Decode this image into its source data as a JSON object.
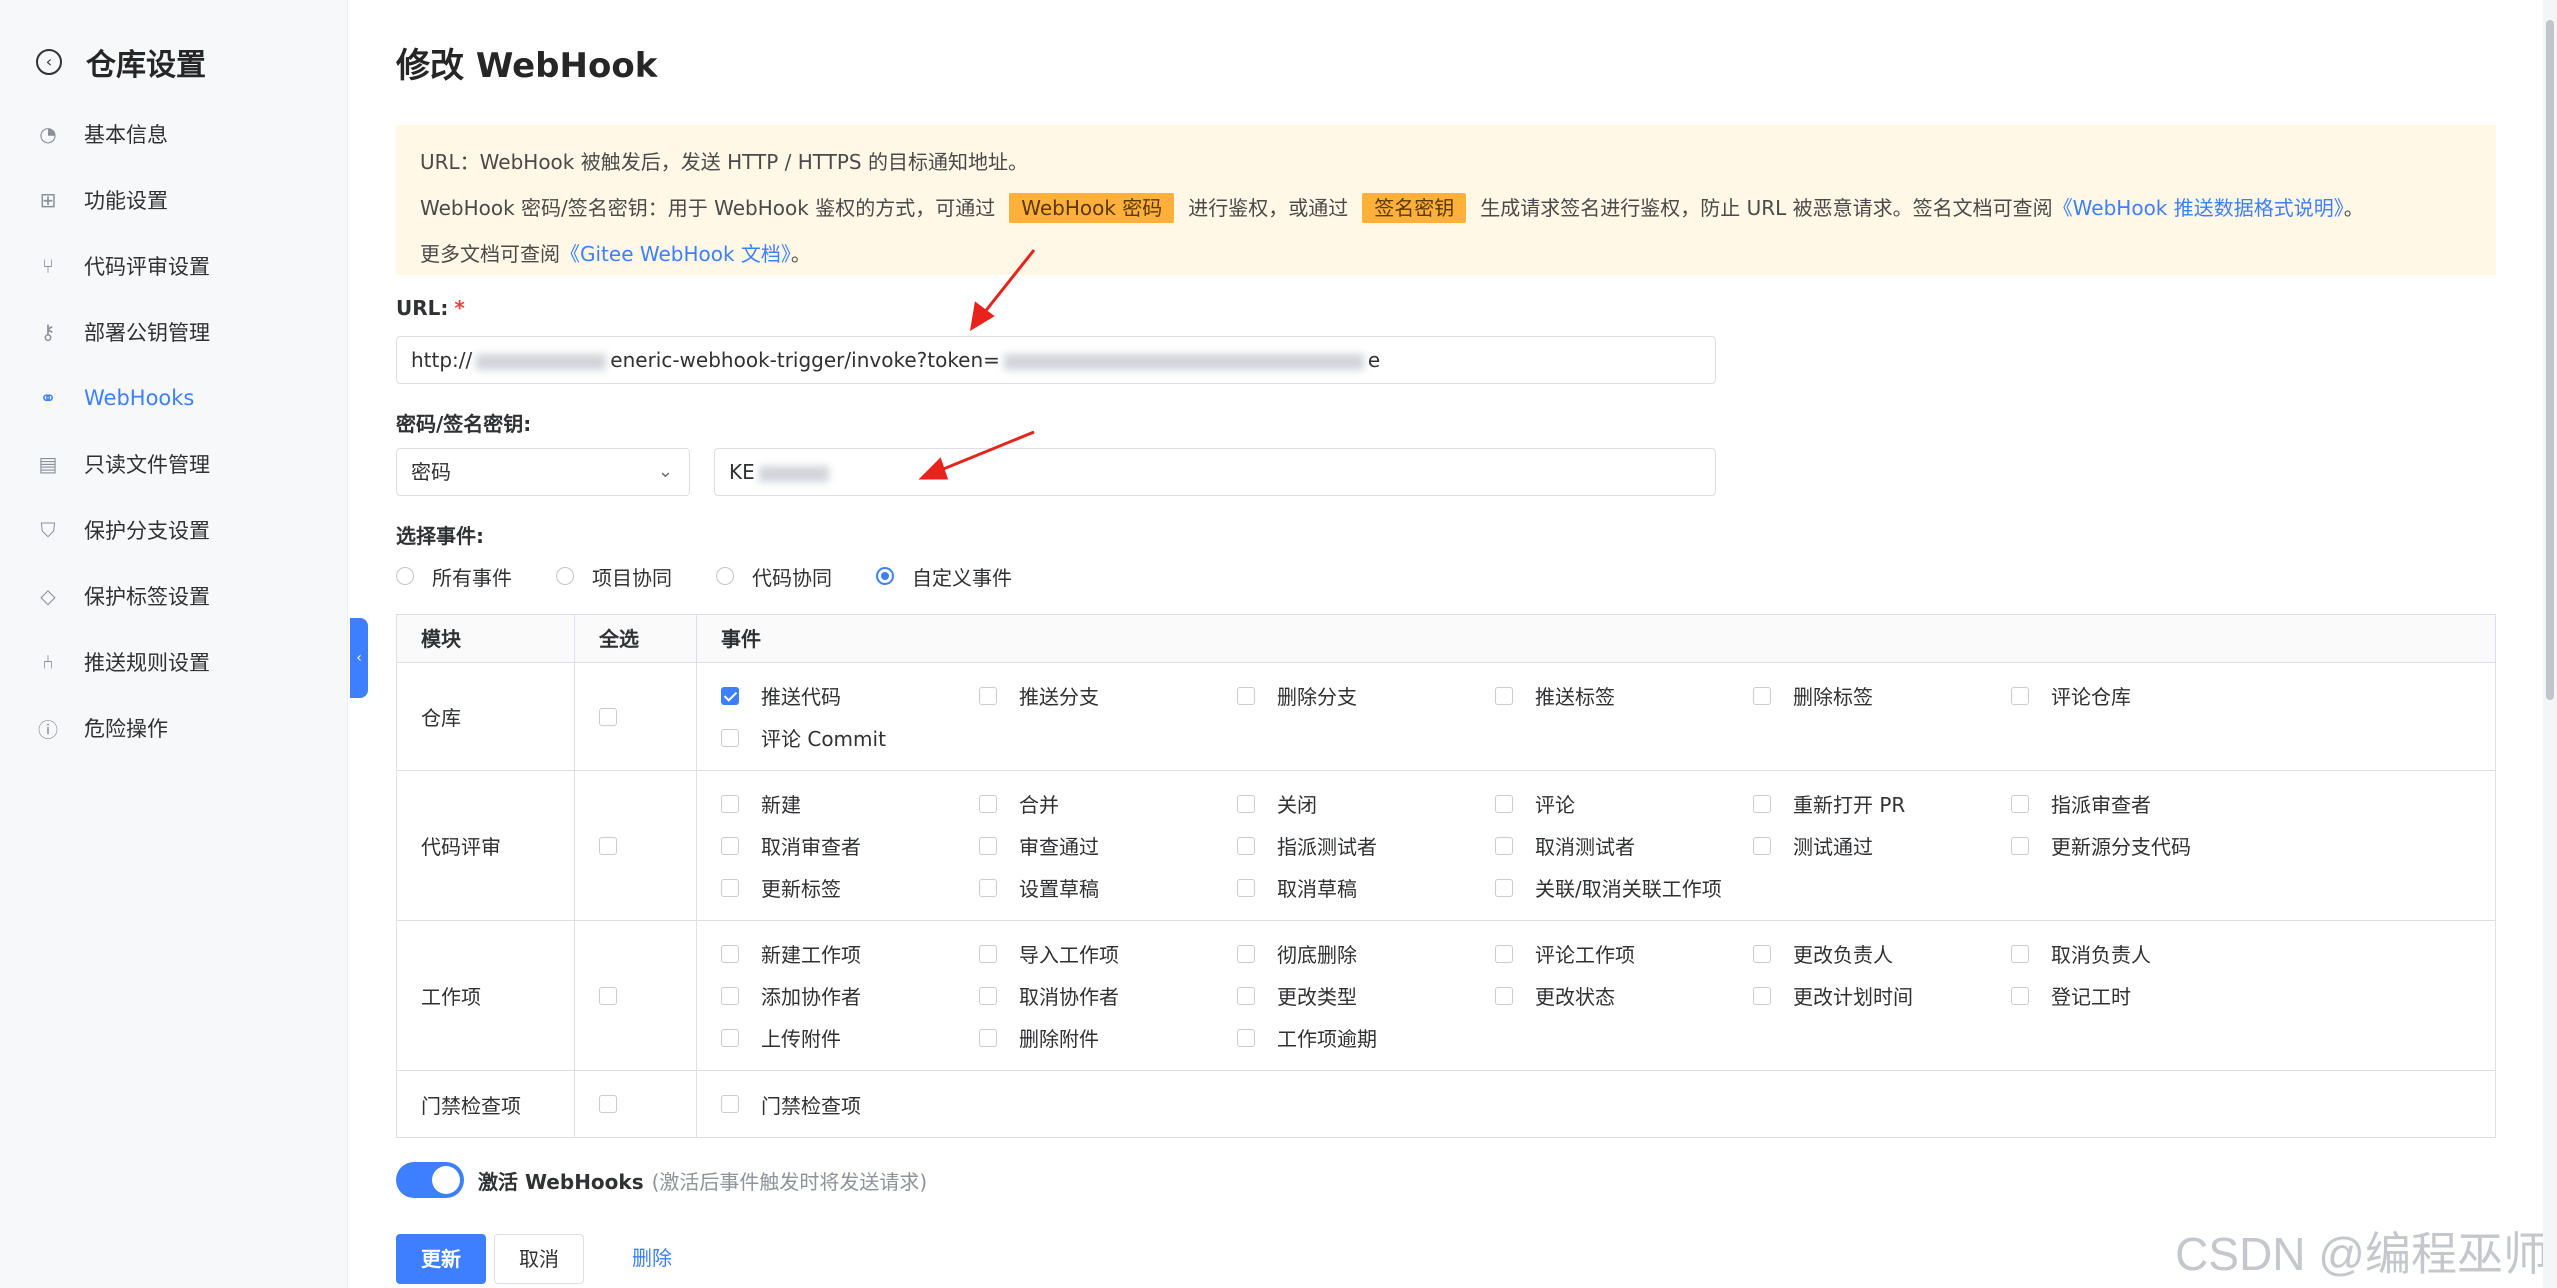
{
  "sidebar": {
    "title": "仓库设置",
    "items": [
      {
        "label": "基本信息",
        "icon": "gauge-icon"
      },
      {
        "label": "功能设置",
        "icon": "grid-icon"
      },
      {
        "label": "代码评审设置",
        "icon": "merge-icon"
      },
      {
        "label": "部署公钥管理",
        "icon": "key-icon"
      },
      {
        "label": "WebHooks",
        "icon": "webhook-icon",
        "active": true
      },
      {
        "label": "只读文件管理",
        "icon": "file-icon"
      },
      {
        "label": "保护分支设置",
        "icon": "shield-icon"
      },
      {
        "label": "保护标签设置",
        "icon": "tag-icon"
      },
      {
        "label": "推送规则设置",
        "icon": "branch-icon"
      },
      {
        "label": "危险操作",
        "icon": "warning-icon"
      }
    ]
  },
  "page": {
    "title": "修改 WebHook"
  },
  "info": {
    "line1": "URL：WebHook 被触发后，发送 HTTP / HTTPS 的目标通知地址。",
    "line2_a": "WebHook 密码/签名密钥：用于 WebHook 鉴权的方式，可通过",
    "tag_password": "WebHook 密码",
    "line2_b": "进行鉴权，或通过",
    "tag_sign": "签名密钥",
    "line2_c": "生成请求签名进行鉴权，防止 URL 被恶意请求。签名文档可查阅",
    "link_push_doc": "《WebHook 推送数据格式说明》",
    "line2_end": "。",
    "line3_a": "更多文档可查阅",
    "link_gitee_doc": "《Gitee WebHook 文档》",
    "line3_end": "。"
  },
  "form": {
    "url_label": "URL:",
    "url_required": "*",
    "url_prefix": "http://",
    "url_middle": "eneric-webhook-trigger/invoke?token=",
    "url_suffix": "e",
    "secret_label": "密码/签名密钥:",
    "secret_type": "密码",
    "secret_value_prefix": "KE",
    "events_label": "选择事件:",
    "event_modes": [
      {
        "label": "所有事件",
        "checked": false
      },
      {
        "label": "项目协同",
        "checked": false
      },
      {
        "label": "代码协同",
        "checked": false
      },
      {
        "label": "自定义事件",
        "checked": true
      }
    ]
  },
  "table": {
    "headers": [
      "模块",
      "全选",
      "事件"
    ],
    "rows": [
      {
        "module": "仓库",
        "events": [
          {
            "label": "推送代码",
            "checked": true
          },
          {
            "label": "推送分支"
          },
          {
            "label": "删除分支"
          },
          {
            "label": "推送标签"
          },
          {
            "label": "删除标签"
          },
          {
            "label": "评论仓库"
          },
          {
            "label": "评论 Commit"
          }
        ]
      },
      {
        "module": "代码评审",
        "events": [
          {
            "label": "新建"
          },
          {
            "label": "合并"
          },
          {
            "label": "关闭"
          },
          {
            "label": "评论"
          },
          {
            "label": "重新打开 PR"
          },
          {
            "label": "指派审查者"
          },
          {
            "label": "取消审查者"
          },
          {
            "label": "审查通过"
          },
          {
            "label": "指派测试者"
          },
          {
            "label": "取消测试者"
          },
          {
            "label": "测试通过"
          },
          {
            "label": "更新源分支代码"
          },
          {
            "label": "更新标签"
          },
          {
            "label": "设置草稿"
          },
          {
            "label": "取消草稿"
          },
          {
            "label": "关联/取消关联工作项"
          }
        ]
      },
      {
        "module": "工作项",
        "events": [
          {
            "label": "新建工作项"
          },
          {
            "label": "导入工作项"
          },
          {
            "label": "彻底删除"
          },
          {
            "label": "评论工作项"
          },
          {
            "label": "更改负责人"
          },
          {
            "label": "取消负责人"
          },
          {
            "label": "添加协作者"
          },
          {
            "label": "取消协作者"
          },
          {
            "label": "更改类型"
          },
          {
            "label": "更改状态"
          },
          {
            "label": "更改计划时间"
          },
          {
            "label": "登记工时"
          },
          {
            "label": "上传附件"
          },
          {
            "label": "删除附件"
          },
          {
            "label": "工作项逾期"
          }
        ]
      },
      {
        "module": "门禁检查项",
        "events": [
          {
            "label": "门禁检查项"
          }
        ]
      }
    ]
  },
  "toggle": {
    "label": "激活 WebHooks",
    "hint": "(激活后事件触发时将发送请求)",
    "on": true
  },
  "buttons": {
    "update": "更新",
    "cancel": "取消",
    "delete": "删除"
  },
  "watermark": "CSDN @编程巫师",
  "colors": {
    "accent": "#3d7fff",
    "warning_bg": "#fff8e6",
    "tag_bg": "#ffb03a",
    "arrow": "#e8231b"
  }
}
